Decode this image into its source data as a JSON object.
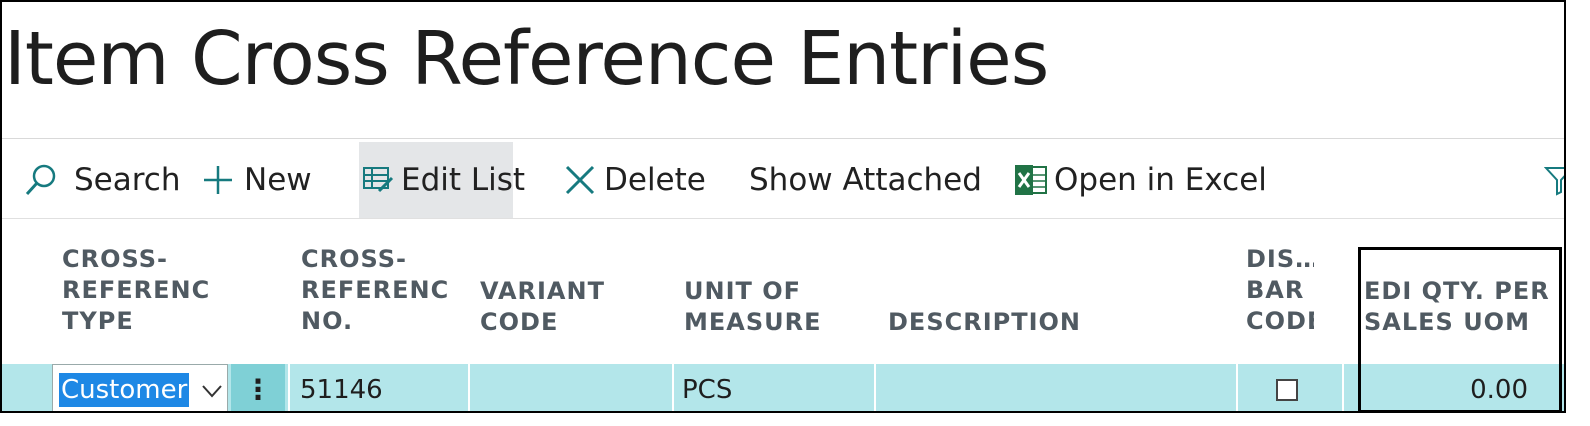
{
  "page": {
    "title": "Item Cross Reference Entries"
  },
  "toolbar": {
    "search": "Search",
    "new": "New",
    "edit_list": "Edit List",
    "delete": "Delete",
    "show_attached": "Show Attached",
    "open_in_excel": "Open in Excel"
  },
  "columns": {
    "cross_ref_type": "CROSS-\nREFERENC\nTYPE",
    "cross_ref_no": "CROSS-\nREFERENC\nNO.",
    "variant_code": "VARIANT\nCODE",
    "unit_of_measure": "UNIT OF\nMEASURE",
    "description": "DESCRIPTION",
    "discontinue_bar_code": "DIS…\nBAR\nCODE",
    "edi_qty_per_sales_uom": "EDI QTY. PER\nSALES UOM"
  },
  "rows": [
    {
      "cross_ref_type": "Customer",
      "cross_ref_no": "51146",
      "variant_code": "",
      "unit_of_measure": "PCS",
      "description": "",
      "discontinue_bar_code": false,
      "edi_qty_per_sales_uom": "0.00"
    }
  ],
  "colors": {
    "row_selected": "#b3e6ea",
    "dropdown_selected": "#1e88e5",
    "excel_green": "#217346",
    "accent_icon": "#167a7f"
  }
}
